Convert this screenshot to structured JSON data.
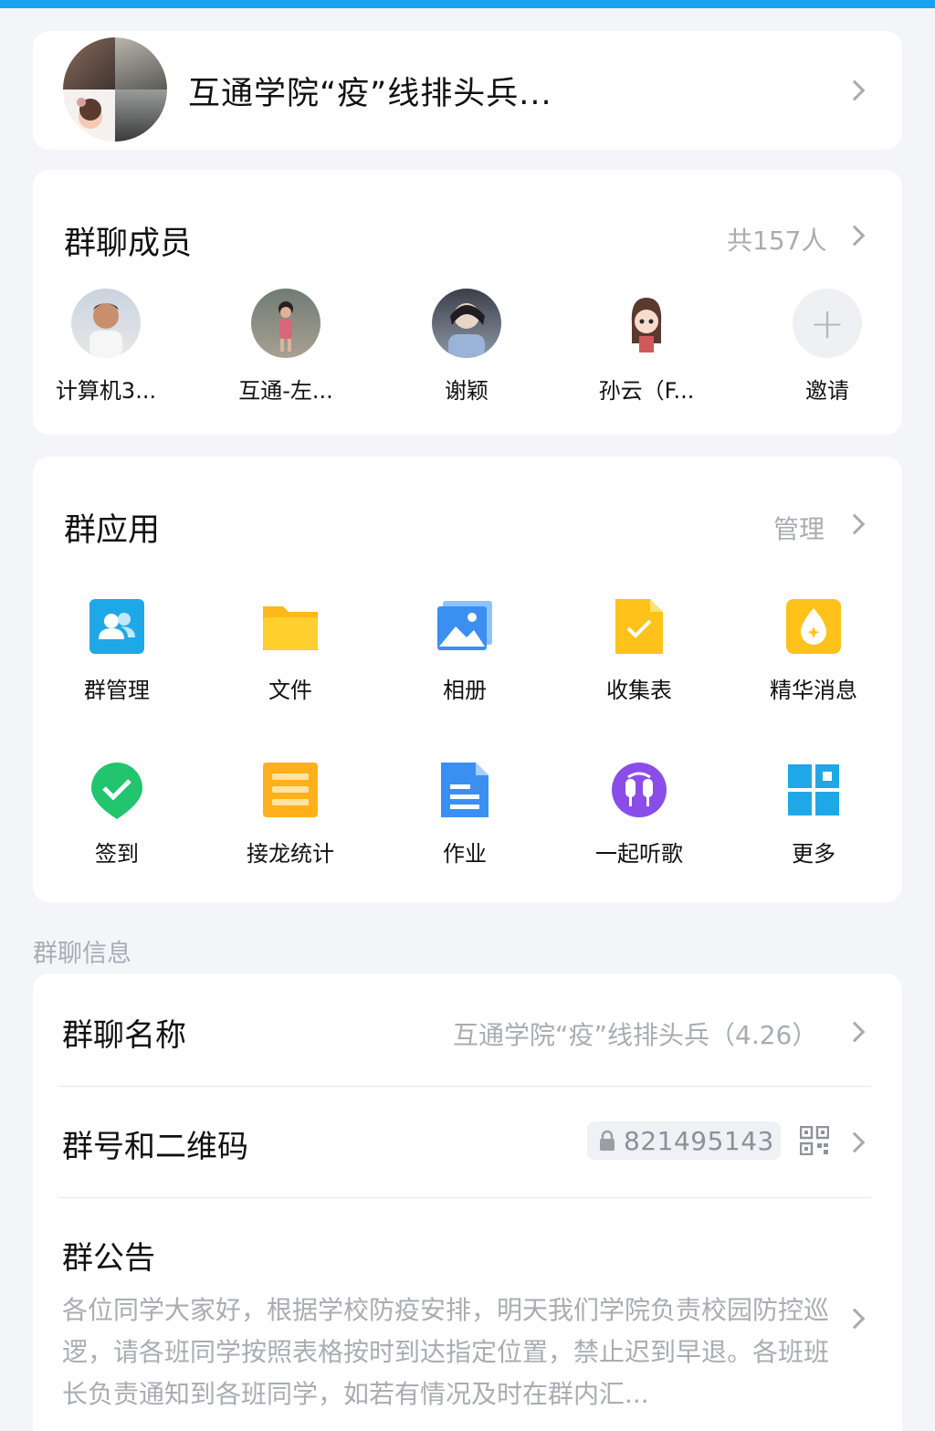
{
  "group": {
    "name": "互通学院“疫”线排头兵..."
  },
  "members": {
    "title": "群聊成员",
    "count_label": "共157人",
    "list": [
      {
        "name": "计算机3..."
      },
      {
        "name": "互通-左..."
      },
      {
        "name": "谢颖"
      },
      {
        "name": "孙云（F..."
      }
    ],
    "invite_label": "邀请",
    "invite_icon": "plus-icon"
  },
  "apps": {
    "title": "群应用",
    "manage_label": "管理",
    "items": [
      {
        "label": "群管理",
        "icon": "group-manage-icon",
        "color": "#1fa8e8"
      },
      {
        "label": "文件",
        "icon": "folder-icon",
        "color": "#ffc21a"
      },
      {
        "label": "相册",
        "icon": "photo-album-icon",
        "color": "#3b8ff0"
      },
      {
        "label": "收集表",
        "icon": "collect-form-icon",
        "color": "#ffc21a"
      },
      {
        "label": "精华消息",
        "icon": "essence-message-icon",
        "color": "#ffc21a"
      },
      {
        "label": "签到",
        "icon": "check-in-icon",
        "color": "#22c46e"
      },
      {
        "label": "接龙统计",
        "icon": "relay-stats-icon",
        "color": "#ffb01a"
      },
      {
        "label": "作业",
        "icon": "homework-icon",
        "color": "#3b8ff0"
      },
      {
        "label": "一起听歌",
        "icon": "listen-together-icon",
        "color": "#8a4de8"
      },
      {
        "label": "更多",
        "icon": "more-apps-icon",
        "color": "#1fa8e8"
      }
    ]
  },
  "info": {
    "section_caption": "群聊信息",
    "name_row": {
      "title": "群聊名称",
      "value": "互通学院“疫”线排头兵（4.26）"
    },
    "id_row": {
      "title": "群号和二维码",
      "value": "821495143"
    },
    "notice_row": {
      "title": "群公告",
      "text": "各位同学大家好，根据学校防疫安排，明天我们学院负责校园防控巡逻，请各班同学按照表格按时到达指定位置，禁止迟到早退。各班班长负责通知到各班同学，如若有情况及时在群内汇..."
    }
  }
}
